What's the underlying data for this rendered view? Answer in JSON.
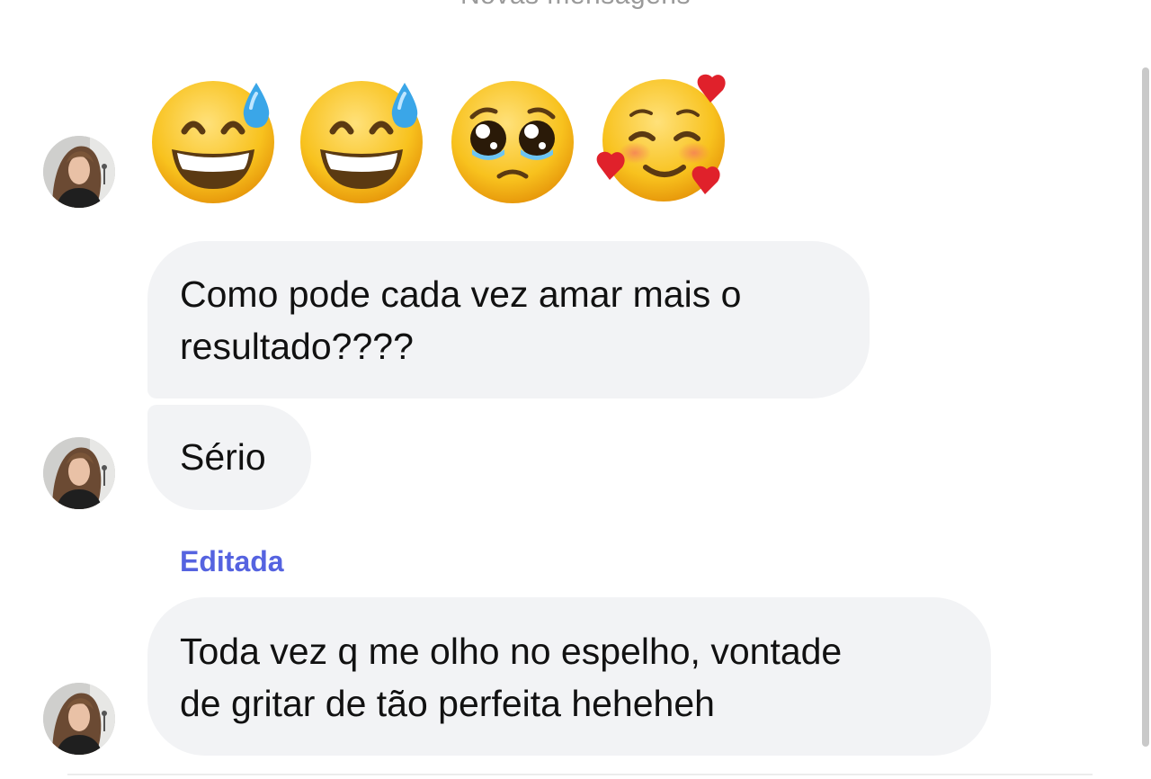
{
  "header": {
    "partial_title": "Novas mensagens"
  },
  "messages": [
    {
      "type": "emojis",
      "emojis": [
        "grinning-face-with-sweat-emoji",
        "grinning-face-with-sweat-emoji",
        "pleading-face-emoji",
        "smiling-face-with-hearts-emoji"
      ]
    },
    {
      "type": "text",
      "lines": [
        "Como pode cada vez amar mais o",
        "resultado????"
      ]
    },
    {
      "type": "text",
      "lines": [
        "Sério"
      ]
    },
    {
      "type": "text",
      "edited_label": "Editada",
      "lines": [
        "Toda vez q me olho no espelho, vontade",
        "de gritar de tão perfeita heheheh"
      ]
    }
  ],
  "colors": {
    "bubble_bg": "#f2f3f5",
    "edited_label": "#5563e0",
    "text": "#111111"
  }
}
